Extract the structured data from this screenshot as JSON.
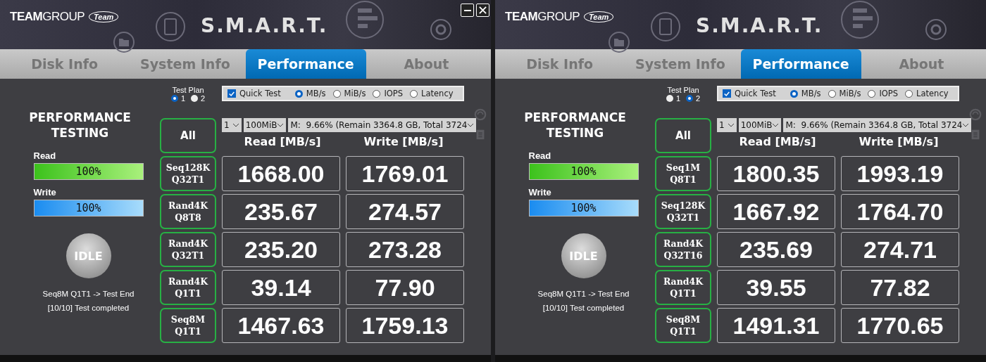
{
  "windows": [
    {
      "logo": {
        "brand": "**TEAM**GROUP",
        "badge": "Team"
      },
      "title": "S.M.A.R.T.",
      "window_buttons": true,
      "tabs": [
        {
          "label": "Disk Info",
          "selected": false
        },
        {
          "label": "System Info",
          "selected": false
        },
        {
          "label": "Performance",
          "selected": true
        },
        {
          "label": "About",
          "selected": false
        }
      ],
      "heading": "PERFORMANCE\nTESTING",
      "meters": [
        {
          "kind": "read",
          "label": "Read",
          "level": 1,
          "reading": "100%"
        },
        {
          "kind": "write",
          "label": "Write",
          "level": 1,
          "reading": "100%"
        }
      ],
      "state_button": "IDLE",
      "status_lines": [
        "Seq8M Q1T1 -> Test End",
        "[10/10] Test completed"
      ],
      "test_plan": {
        "label": "Test Plan",
        "options": [
          {
            "label": "1",
            "selected": true
          },
          {
            "label": "2",
            "selected": false
          }
        ]
      },
      "quick_test": {
        "label": "Quick Test",
        "checked": true
      },
      "units": [
        {
          "label": "MB/s",
          "selected": true
        },
        {
          "label": "MiB/s",
          "selected": false
        },
        {
          "label": "IOPS",
          "selected": false
        },
        {
          "label": "Latency",
          "selected": false
        }
      ],
      "selects": [
        "1",
        "100MiB",
        "M:  9.66% (Remain 3364.8 GB, Total 3724"
      ],
      "all_button": "All",
      "columns": [
        "Read [MB/s]",
        "Write [MB/s]"
      ],
      "rows": [
        {
          "test": "Seq128K\nQ32T1",
          "read": "1668.00",
          "write": "1769.01"
        },
        {
          "test": "Rand4K\nQ8T8",
          "read": "235.67",
          "write": "274.57"
        },
        {
          "test": "Rand4K\nQ32T1",
          "read": "235.20",
          "write": "273.28"
        },
        {
          "test": "Rand4K\nQ1T1",
          "read": "39.14",
          "write": "77.90"
        },
        {
          "test": "Seq8M\nQ1T1",
          "read": "1467.63",
          "write": "1759.13"
        }
      ]
    },
    {
      "logo": {
        "brand": "**TEAM**GROUP",
        "badge": "Team"
      },
      "title": "S.M.A.R.T.",
      "window_buttons": false,
      "tabs": [
        {
          "label": "Disk Info",
          "selected": false
        },
        {
          "label": "System Info",
          "selected": false
        },
        {
          "label": "Performance",
          "selected": true
        },
        {
          "label": "About",
          "selected": false
        }
      ],
      "heading": "PERFORMANCE\nTESTING",
      "meters": [
        {
          "kind": "read",
          "label": "Read",
          "level": 1,
          "reading": "100%"
        },
        {
          "kind": "write",
          "label": "Write",
          "level": 1,
          "reading": "100%"
        }
      ],
      "state_button": "IDLE",
      "status_lines": [
        "Seq8M Q1T1 -> Test End",
        "[10/10] Test completed"
      ],
      "test_plan": {
        "label": "Test Plan",
        "options": [
          {
            "label": "1",
            "selected": false
          },
          {
            "label": "2",
            "selected": true
          }
        ]
      },
      "quick_test": {
        "label": "Quick Test",
        "checked": true
      },
      "units": [
        {
          "label": "MB/s",
          "selected": true
        },
        {
          "label": "MiB/s",
          "selected": false
        },
        {
          "label": "IOPS",
          "selected": false
        },
        {
          "label": "Latency",
          "selected": false
        }
      ],
      "selects": [
        "1",
        "100MiB",
        "M:  9.66% (Remain 3364.8 GB, Total 3724"
      ],
      "all_button": "All",
      "columns": [
        "Read [MB/s]",
        "Write [MB/s]"
      ],
      "rows": [
        {
          "test": "Seq1M\nQ8T1",
          "read": "1800.35",
          "write": "1993.19"
        },
        {
          "test": "Seq128K\nQ32T1",
          "read": "1667.92",
          "write": "1764.70"
        },
        {
          "test": "Rand4K\nQ32T16",
          "read": "235.69",
          "write": "274.71"
        },
        {
          "test": "Rand4K\nQ1T1",
          "read": "39.55",
          "write": "77.82"
        },
        {
          "test": "Seq8M\nQ1T1",
          "read": "1491.31",
          "write": "1770.65"
        }
      ]
    }
  ]
}
